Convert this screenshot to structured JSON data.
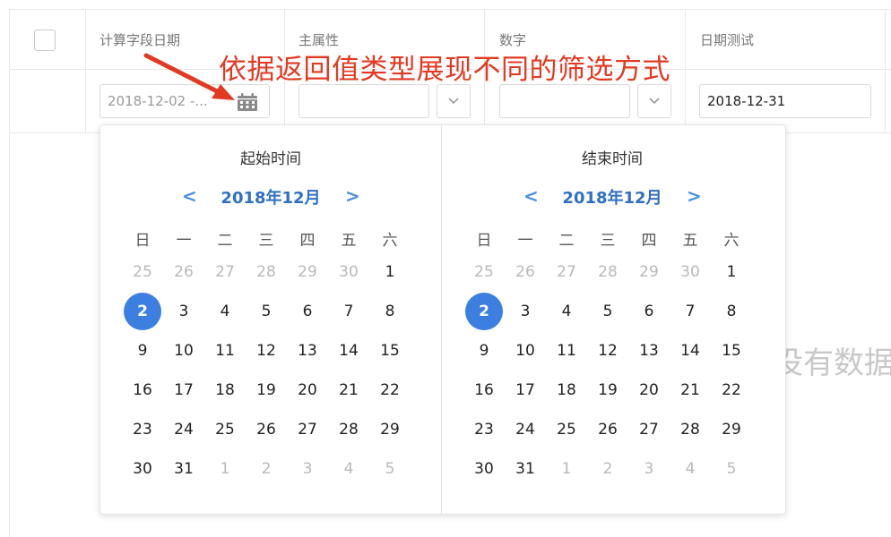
{
  "header": {
    "columns": [
      "计算字段日期",
      "主属性",
      "数字",
      "日期测试"
    ]
  },
  "filters": {
    "date_range_value": "2018-12-02 -...",
    "date_value": "2018-12-31"
  },
  "annotation": "依据返回值类型展现不同的筛选方式",
  "empty_text": "没有数据",
  "picker": {
    "start_title": "起始时间",
    "end_title": "结束时间",
    "month_label": "2018年12月",
    "prev_label": "<",
    "next_label": ">",
    "weekdays": [
      "日",
      "一",
      "二",
      "三",
      "四",
      "五",
      "六"
    ],
    "weeks": [
      [
        25,
        26,
        27,
        28,
        29,
        30,
        1
      ],
      [
        2,
        3,
        4,
        5,
        6,
        7,
        8
      ],
      [
        9,
        10,
        11,
        12,
        13,
        14,
        15
      ],
      [
        16,
        17,
        18,
        19,
        20,
        21,
        22
      ],
      [
        23,
        24,
        25,
        26,
        27,
        28,
        29
      ],
      [
        30,
        31,
        1,
        2,
        3,
        4,
        5
      ]
    ],
    "muted": [
      [
        true,
        true,
        true,
        true,
        true,
        true,
        false
      ],
      [
        false,
        false,
        false,
        false,
        false,
        false,
        false
      ],
      [
        false,
        false,
        false,
        false,
        false,
        false,
        false
      ],
      [
        false,
        false,
        false,
        false,
        false,
        false,
        false
      ],
      [
        false,
        false,
        false,
        false,
        false,
        false,
        false
      ],
      [
        false,
        false,
        true,
        true,
        true,
        true,
        true
      ]
    ],
    "selected_day": 2
  },
  "colors": {
    "accent": "#3d7fe0",
    "annotation": "#e23a22"
  }
}
